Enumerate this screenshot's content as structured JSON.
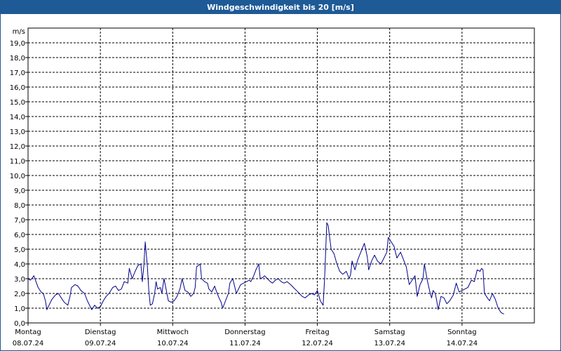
{
  "window": {
    "title": "Windgeschwindigkeit bis 20 [m/s]"
  },
  "colors": {
    "title_bar": "#1e5a96",
    "series_line": "#00008b",
    "grid": "#000000"
  },
  "chart_data": {
    "type": "line",
    "title": "Windgeschwindigkeit bis 20 [m/s]",
    "ylabel": "m/s",
    "ylim": [
      0,
      20
    ],
    "y_ticks": [
      "0,0",
      "1,0",
      "2,0",
      "3,0",
      "4,0",
      "5,0",
      "6,0",
      "7,0",
      "8,0",
      "9,0",
      "10,0",
      "11,0",
      "12,0",
      "13,0",
      "14,0",
      "15,0",
      "16,0",
      "17,0",
      "18,0",
      "19,0"
    ],
    "x_ticks": [
      {
        "day": "Montag",
        "date": "08.07.24"
      },
      {
        "day": "Dienstag",
        "date": "09.07.24"
      },
      {
        "day": "Mittwoch",
        "date": "10.07.24"
      },
      {
        "day": "Donnerstag",
        "date": "11.07.24"
      },
      {
        "day": "Freitag",
        "date": "12.07.24"
      },
      {
        "day": "Samstag",
        "date": "13.07.24"
      },
      {
        "day": "Sonntag",
        "date": "14.07.24"
      }
    ],
    "xlim": [
      0,
      7
    ],
    "grid": true,
    "x_unit": "days from 08.07.24 00:00",
    "series": [
      {
        "name": "",
        "points": [
          [
            0.0,
            3.0
          ],
          [
            0.03,
            2.9
          ],
          [
            0.05,
            3.0
          ],
          [
            0.08,
            3.2
          ],
          [
            0.11,
            2.8
          ],
          [
            0.14,
            2.4
          ],
          [
            0.18,
            2.1
          ],
          [
            0.21,
            2.0
          ],
          [
            0.24,
            1.5
          ],
          [
            0.26,
            0.9
          ],
          [
            0.29,
            1.2
          ],
          [
            0.33,
            1.6
          ],
          [
            0.38,
            1.9
          ],
          [
            0.42,
            2.0
          ],
          [
            0.46,
            1.7
          ],
          [
            0.5,
            1.4
          ],
          [
            0.55,
            1.2
          ],
          [
            0.58,
            1.8
          ],
          [
            0.6,
            2.4
          ],
          [
            0.65,
            2.6
          ],
          [
            0.69,
            2.5
          ],
          [
            0.73,
            2.2
          ],
          [
            0.78,
            2.0
          ],
          [
            0.82,
            1.5
          ],
          [
            0.85,
            1.2
          ],
          [
            0.88,
            0.9
          ],
          [
            0.92,
            1.2
          ],
          [
            0.96,
            1.0
          ],
          [
            1.0,
            1.1
          ],
          [
            1.04,
            1.5
          ],
          [
            1.08,
            1.8
          ],
          [
            1.12,
            2.0
          ],
          [
            1.17,
            2.4
          ],
          [
            1.21,
            2.5
          ],
          [
            1.25,
            2.2
          ],
          [
            1.29,
            2.3
          ],
          [
            1.33,
            2.8
          ],
          [
            1.38,
            2.7
          ],
          [
            1.4,
            3.7
          ],
          [
            1.44,
            3.0
          ],
          [
            1.48,
            3.5
          ],
          [
            1.52,
            3.9
          ],
          [
            1.56,
            4.0
          ],
          [
            1.58,
            2.8
          ],
          [
            1.6,
            3.8
          ],
          [
            1.62,
            5.5
          ],
          [
            1.65,
            3.8
          ],
          [
            1.67,
            2.2
          ],
          [
            1.69,
            1.2
          ],
          [
            1.72,
            1.3
          ],
          [
            1.75,
            2.0
          ],
          [
            1.77,
            2.8
          ],
          [
            1.79,
            2.3
          ],
          [
            1.83,
            2.4
          ],
          [
            1.85,
            2.0
          ],
          [
            1.88,
            3.0
          ],
          [
            1.92,
            2.0
          ],
          [
            1.94,
            1.5
          ],
          [
            1.98,
            1.4
          ],
          [
            2.02,
            1.5
          ],
          [
            2.06,
            1.8
          ],
          [
            2.1,
            2.3
          ],
          [
            2.13,
            3.0
          ],
          [
            2.17,
            2.2
          ],
          [
            2.21,
            2.1
          ],
          [
            2.25,
            1.8
          ],
          [
            2.29,
            2.0
          ],
          [
            2.31,
            2.4
          ],
          [
            2.33,
            3.8
          ],
          [
            2.38,
            4.0
          ],
          [
            2.4,
            3.0
          ],
          [
            2.44,
            2.8
          ],
          [
            2.48,
            2.7
          ],
          [
            2.5,
            2.3
          ],
          [
            2.54,
            2.1
          ],
          [
            2.58,
            2.5
          ],
          [
            2.6,
            2.2
          ],
          [
            2.64,
            1.7
          ],
          [
            2.67,
            1.4
          ],
          [
            2.69,
            1.0
          ],
          [
            2.73,
            1.5
          ],
          [
            2.77,
            2.0
          ],
          [
            2.79,
            2.7
          ],
          [
            2.83,
            3.0
          ],
          [
            2.88,
            2.0
          ],
          [
            2.9,
            2.2
          ],
          [
            2.94,
            2.6
          ],
          [
            2.98,
            2.7
          ],
          [
            3.02,
            2.8
          ],
          [
            3.06,
            2.9
          ],
          [
            3.08,
            2.8
          ],
          [
            3.12,
            3.2
          ],
          [
            3.15,
            3.6
          ],
          [
            3.19,
            4.0
          ],
          [
            3.21,
            3.0
          ],
          [
            3.25,
            3.1
          ],
          [
            3.27,
            3.2
          ],
          [
            3.31,
            3.0
          ],
          [
            3.35,
            2.8
          ],
          [
            3.38,
            2.7
          ],
          [
            3.42,
            2.9
          ],
          [
            3.46,
            3.0
          ],
          [
            3.5,
            2.8
          ],
          [
            3.54,
            2.7
          ],
          [
            3.58,
            2.8
          ],
          [
            3.63,
            2.6
          ],
          [
            3.67,
            2.4
          ],
          [
            3.71,
            2.2
          ],
          [
            3.75,
            2.0
          ],
          [
            3.79,
            1.8
          ],
          [
            3.83,
            1.7
          ],
          [
            3.88,
            1.9
          ],
          [
            3.92,
            2.0
          ],
          [
            3.96,
            1.9
          ],
          [
            4.0,
            2.2
          ],
          [
            4.04,
            1.5
          ],
          [
            4.08,
            1.2
          ],
          [
            4.1,
            3.0
          ],
          [
            4.13,
            6.8
          ],
          [
            4.15,
            6.6
          ],
          [
            4.19,
            5.0
          ],
          [
            4.23,
            4.7
          ],
          [
            4.27,
            4.0
          ],
          [
            4.31,
            3.5
          ],
          [
            4.35,
            3.3
          ],
          [
            4.4,
            3.5
          ],
          [
            4.44,
            3.0
          ],
          [
            4.46,
            3.3
          ],
          [
            4.48,
            4.2
          ],
          [
            4.52,
            3.6
          ],
          [
            4.56,
            4.3
          ],
          [
            4.6,
            4.8
          ],
          [
            4.65,
            5.4
          ],
          [
            4.69,
            4.5
          ],
          [
            4.71,
            3.6
          ],
          [
            4.75,
            4.2
          ],
          [
            4.79,
            4.6
          ],
          [
            4.83,
            4.2
          ],
          [
            4.88,
            4.0
          ],
          [
            4.92,
            4.4
          ],
          [
            4.96,
            4.8
          ],
          [
            4.98,
            5.8
          ],
          [
            5.02,
            5.5
          ],
          [
            5.06,
            5.2
          ],
          [
            5.1,
            4.4
          ],
          [
            5.15,
            4.8
          ],
          [
            5.19,
            4.3
          ],
          [
            5.23,
            3.8
          ],
          [
            5.25,
            3.2
          ],
          [
            5.27,
            2.6
          ],
          [
            5.31,
            2.9
          ],
          [
            5.35,
            3.2
          ],
          [
            5.38,
            1.8
          ],
          [
            5.42,
            2.6
          ],
          [
            5.46,
            3.0
          ],
          [
            5.48,
            4.0
          ],
          [
            5.52,
            2.9
          ],
          [
            5.56,
            2.0
          ],
          [
            5.58,
            1.7
          ],
          [
            5.6,
            2.2
          ],
          [
            5.63,
            2.0
          ],
          [
            5.65,
            1.5
          ],
          [
            5.67,
            0.9
          ],
          [
            5.71,
            1.8
          ],
          [
            5.75,
            1.7
          ],
          [
            5.79,
            1.3
          ],
          [
            5.83,
            1.5
          ],
          [
            5.88,
            1.9
          ],
          [
            5.92,
            2.7
          ],
          [
            5.96,
            2.1
          ],
          [
            6.0,
            2.2
          ],
          [
            6.04,
            2.3
          ],
          [
            6.08,
            2.4
          ],
          [
            6.13,
            2.9
          ],
          [
            6.17,
            2.8
          ],
          [
            6.21,
            3.6
          ],
          [
            6.25,
            3.5
          ],
          [
            6.27,
            3.7
          ],
          [
            6.29,
            3.6
          ],
          [
            6.31,
            2.0
          ],
          [
            6.35,
            1.7
          ],
          [
            6.38,
            1.5
          ],
          [
            6.42,
            2.0
          ],
          [
            6.46,
            1.6
          ],
          [
            6.5,
            1.0
          ],
          [
            6.54,
            0.7
          ],
          [
            6.58,
            0.6
          ]
        ]
      }
    ]
  }
}
